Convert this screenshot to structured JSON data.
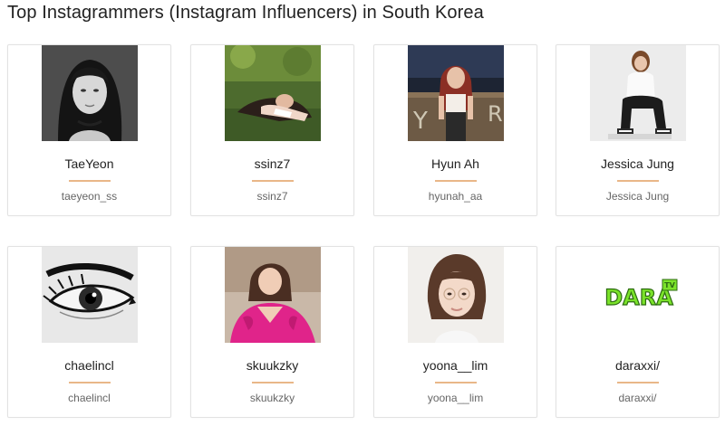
{
  "page": {
    "title": "Top Instagrammers (Instagram Influencers) in South Korea"
  },
  "influencers": [
    {
      "name": "TaeYeon",
      "handle": "taeyeon_ss",
      "photo": "portrait-photo"
    },
    {
      "name": "ssinz7",
      "handle": "ssinz7",
      "photo": "portrait-photo"
    },
    {
      "name": "Hyun Ah",
      "handle": "hyunah_aa",
      "photo": "portrait-photo"
    },
    {
      "name": "Jessica Jung",
      "handle": "Jessica Jung",
      "photo": "portrait-photo"
    },
    {
      "name": "chaelincl",
      "handle": "chaelincl",
      "photo": "eye-art-photo"
    },
    {
      "name": "skuukzky",
      "handle": "skuukzky",
      "photo": "portrait-photo"
    },
    {
      "name": "yoona__lim",
      "handle": "yoona__lim",
      "photo": "portrait-photo"
    },
    {
      "name": "daraxxi/",
      "handle": "daraxxi/",
      "photo": "dara-tv-logo",
      "logo_text": "DARA",
      "logo_badge": "TV"
    }
  ],
  "colors": {
    "accent_divider": "#e9b788",
    "card_border": "#e2e2e2",
    "logo_green": "#7be32a"
  }
}
